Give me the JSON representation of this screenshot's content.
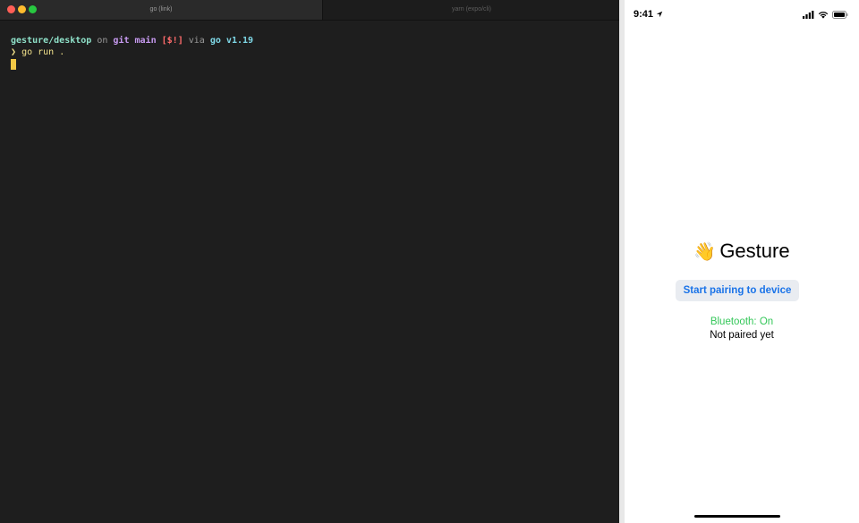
{
  "terminal": {
    "tabs": [
      {
        "label": "go (link)"
      },
      {
        "label": "yarn (expo/cli)"
      }
    ],
    "prompt": {
      "path": "gesture/desktop",
      "on_word": "on",
      "git_label": "git",
      "branch": "main",
      "status": "[$!]",
      "via_word": "via",
      "lang": "go v1.19"
    },
    "command": {
      "arrow": "❯",
      "text": "go run ."
    }
  },
  "phone": {
    "status_bar": {
      "time": "9:41"
    },
    "app": {
      "wave_emoji": "👋",
      "title": "Gesture",
      "pair_button_label": "Start pairing to device",
      "bluetooth_status": "Bluetooth: On",
      "pairing_status": "Not paired yet"
    }
  },
  "colors": {
    "accent_blue": "#1a73e8",
    "bluetooth_green": "#34c759",
    "terminal_bg": "#1e1e1e",
    "cursor": "#f3c845"
  }
}
